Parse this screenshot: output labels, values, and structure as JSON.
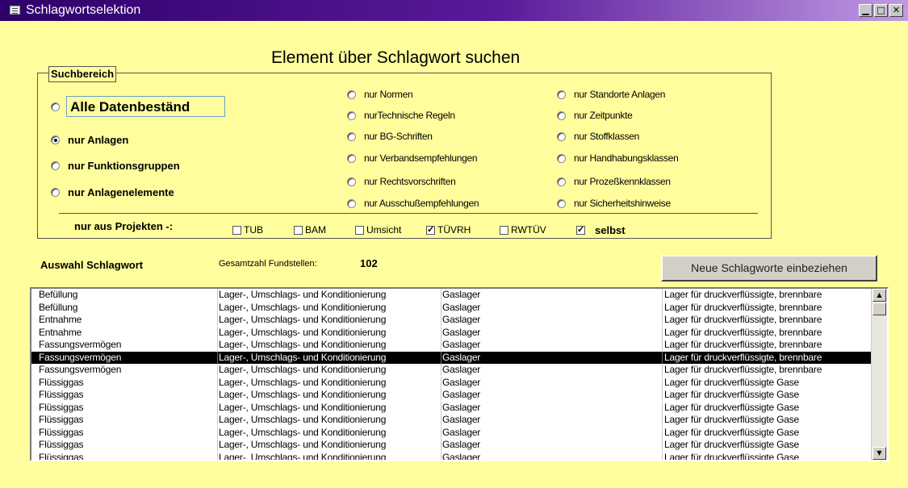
{
  "window": {
    "title": "Schlagwortselektion",
    "controls": {
      "minimize": "▁",
      "maximize": "□",
      "close": "✕"
    }
  },
  "heading": "Element über Schlagwort suchen",
  "search_area": {
    "legend": "Suchbereich",
    "left_options": [
      {
        "label": "Alle Datenbeständ",
        "selected": false
      },
      {
        "label": "nur Anlagen",
        "selected": true
      },
      {
        "label": "nur Funktionsgruppen",
        "selected": false
      },
      {
        "label": "nur Anlagenelemente",
        "selected": false
      }
    ],
    "middle_options": [
      {
        "label": "nur Normen",
        "selected": false
      },
      {
        "label": "nurTechnische Regeln",
        "selected": false
      },
      {
        "label": "nur BG-Schriften",
        "selected": false
      },
      {
        "label": "nur Verbandsempfehlungen",
        "selected": false
      },
      {
        "label": "nur Rechtsvorschriften",
        "selected": false
      },
      {
        "label": "nur Ausschußempfehlungen",
        "selected": false
      }
    ],
    "right_options": [
      {
        "label": "nur Standorte Anlagen",
        "selected": false
      },
      {
        "label": "nur Zeitpunkte",
        "selected": false
      },
      {
        "label": "nur Stoffklassen",
        "selected": false
      },
      {
        "label": "nur Handhabungsklassen",
        "selected": false
      },
      {
        "label": "nur Prozeßkennklassen",
        "selected": false
      },
      {
        "label": "nur Sicherheitshinweise",
        "selected": false
      }
    ],
    "projects_label": "nur aus Projekten  -:",
    "projects": [
      {
        "label": "TUB",
        "checked": false
      },
      {
        "label": "BAM",
        "checked": false
      },
      {
        "label": "Umsicht",
        "checked": false
      },
      {
        "label": "TÜVRH",
        "checked": true
      },
      {
        "label": "RWTÜV",
        "checked": false
      },
      {
        "label": "selbst",
        "checked": true
      }
    ]
  },
  "results": {
    "title": "Auswahl Schlagwort",
    "count_label": "Gesamtzahl Fundstellen:",
    "count_value": "102",
    "button_label": "Neue Schlagworte einbeziehen",
    "selected_index": 5,
    "rows": [
      [
        "Befüllung",
        "Lager-, Umschlags- und Konditionierung",
        "Gaslager",
        "Lager für druckverflüssigte, brennbare"
      ],
      [
        "Befüllung",
        "Lager-, Umschlags- und Konditionierung",
        "Gaslager",
        "Lager für druckverflüssigte, brennbare"
      ],
      [
        "Entnahme",
        "Lager-, Umschlags- und Konditionierung",
        "Gaslager",
        "Lager für druckverflüssigte, brennbare"
      ],
      [
        "Entnahme",
        "Lager-, Umschlags- und Konditionierung",
        "Gaslager",
        "Lager für druckverflüssigte, brennbare"
      ],
      [
        "Fassungsvermögen",
        "Lager-, Umschlags- und Konditionierung",
        "Gaslager",
        "Lager für druckverflüssigte, brennbare"
      ],
      [
        "Fassungsvermögen",
        "Lager-, Umschlags- und Konditionierung",
        "Gaslager",
        "Lager für druckverflüssigte, brennbare"
      ],
      [
        "Fassungsvermögen",
        "Lager-, Umschlags- und Konditionierung",
        "Gaslager",
        "Lager für druckverflüssigte, brennbare"
      ],
      [
        "Flüssiggas",
        "Lager-, Umschlags- und Konditionierung",
        "Gaslager",
        "Lager für druckverflüssigte Gase"
      ],
      [
        "Flüssiggas",
        "Lager-, Umschlags- und Konditionierung",
        "Gaslager",
        "Lager für druckverflüssigte Gase"
      ],
      [
        "Flüssiggas",
        "Lager-, Umschlags- und Konditionierung",
        "Gaslager",
        "Lager für druckverflüssigte Gase"
      ],
      [
        "Flüssiggas",
        "Lager-, Umschlags- und Konditionierung",
        "Gaslager",
        "Lager für druckverflüssigte Gase"
      ],
      [
        "Flüssiggas",
        "Lager-, Umschlags- und Konditionierung",
        "Gaslager",
        "Lager für druckverflüssigte Gase"
      ],
      [
        "Flüssiggas",
        "Lager-, Umschlags- und Konditionierung",
        "Gaslager",
        "Lager für druckverflüssigte Gase"
      ],
      [
        "Flüssiggas",
        "Lager-, Umschlags- und Konditionierung",
        "Gaslager",
        "Lager für druckverflüssigte Gase"
      ]
    ],
    "scroll": {
      "up": "▲",
      "down": "▼"
    }
  },
  "colors": {
    "background": "#fffd9c",
    "title_bar_start": "#2e006a",
    "title_bar_end": "#c09ae4",
    "selection": "#000000"
  },
  "icons": {
    "app": "form-icon",
    "minimize": "minimize-icon",
    "maximize": "maximize-icon",
    "close": "close-icon",
    "scroll_up": "arrow-up-icon",
    "scroll_down": "arrow-down-icon"
  }
}
